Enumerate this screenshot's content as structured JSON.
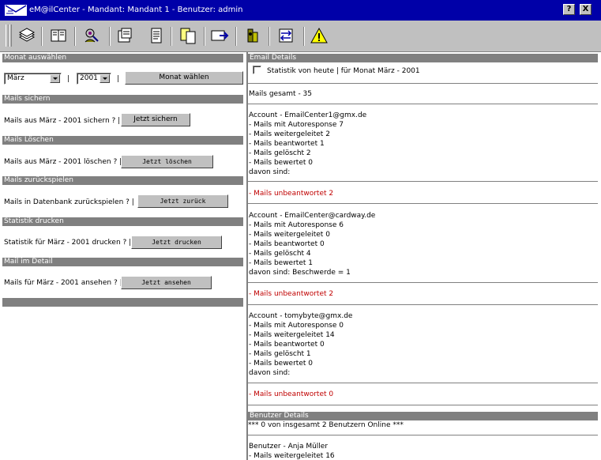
{
  "window": {
    "title": "eM@ilCenter - Mandant: Mandant 1 - Benutzer: admin",
    "help_label": "?",
    "close_label": "X"
  },
  "toolbar": {
    "icons": [
      "mail-stack-icon",
      "book-icon",
      "user-search-icon",
      "properties-icon",
      "notepad-icon",
      "copy-icon",
      "send-icon",
      "tools-icon",
      "transfer-icon",
      "warning-icon"
    ]
  },
  "left": {
    "monat": {
      "header": "Monat auswählen",
      "month": "März",
      "year": "2001",
      "sep": "|",
      "button": "Monat wählen"
    },
    "sichern": {
      "header": "Mails sichern",
      "text": "Mails aus März - 2001 sichern ? |",
      "button": "Jetzt sichern"
    },
    "loeschen": {
      "header": "Mails Löschen",
      "text": "Mails aus März - 2001 löschen ? |",
      "button": "Jetzt löschen"
    },
    "zurueck": {
      "header": "Mails zurückspielen",
      "text": "Mails in Datenbank zurückspielen ? |",
      "button": "Jetzt zurück"
    },
    "drucken": {
      "header": "Statistik drucken",
      "text": "Statistik für März - 2001 drucken ? |",
      "button": "Jetzt drucken"
    },
    "detail": {
      "header": "Mail im Detail",
      "text": "Mails für März - 2001 ansehen ? |",
      "button": "Jetzt ansehen"
    }
  },
  "right": {
    "email_header": "Email Details",
    "checkbox_label": "Statistik von heute | für Monat März - 2001",
    "total": "Mails gesamt - 35",
    "accounts": [
      {
        "account": "Account - EmailCenter1@gmx.de",
        "lines": [
          "- Mails mit Autoresponse 7",
          "- Mails weitergeleitet 2",
          "- Mails beantwortet 1",
          "- Mails gelöscht 2",
          "- Mails bewertet 0",
          "davon sind:"
        ],
        "unanswered": "- Mails unbeantwortet 2"
      },
      {
        "account": "Account - EmailCenter@cardway.de",
        "lines": [
          "- Mails mit Autoresponse 6",
          "- Mails weitergeleitet 0",
          "- Mails beantwortet 0",
          "- Mails gelöscht 4",
          "- Mails bewertet 1",
          "davon sind: Beschwerde = 1"
        ],
        "unanswered": "- Mails unbeantwortet 2"
      },
      {
        "account": "Account - tomybyte@gmx.de",
        "lines": [
          "- Mails mit Autoresponse 0",
          "- Mails weitergeleitet 14",
          "- Mails beantwortet 0",
          "- Mails gelöscht 1",
          "- Mails bewertet 0",
          "davon sind:"
        ],
        "unanswered": "- Mails unbeantwortet 0"
      }
    ],
    "benutzer_header": "Benutzer Details",
    "online": "*** 0 von insgesamt 2 Benutzern Online ***",
    "user": "Benutzer - Anja Müller",
    "user_line": "- Mails weitergeleitet 16"
  }
}
